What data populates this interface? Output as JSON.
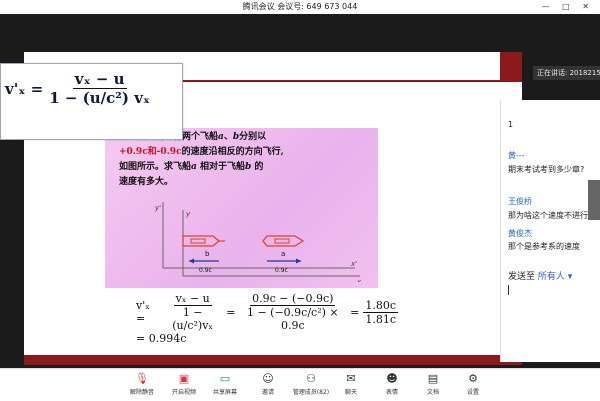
{
  "titlebar": {
    "title": "腾讯会议 会议号: 649 673 044",
    "window_controls": "— □ ✕"
  },
  "slide": {
    "title_glyphs": "",
    "problem": {
      "prefix": "在地面上测到有两个飞船",
      "line1_a": "a",
      "line1_sep": "、",
      "line1_b": "b",
      "line1_end": "分别以",
      "line2_red": "+0.9c和-0.9c",
      "line2_rest": "的速度沿相反的方向飞行,",
      "line3": "如图所示。求飞船",
      "line3_a": "a",
      "line3_mid": " 相对于飞船",
      "line3_b": "b",
      "line3_end": " 的",
      "line4": "速度有多大。"
    },
    "diagram": {
      "yprime": "y'",
      "y": "y",
      "xprime": "x'",
      "x": "x",
      "ship_b": "b",
      "ship_a": "a",
      "vel_b": "0.9c",
      "vel_a": "0.9c",
      "colors": {
        "ship": "#d9462a",
        "arrow": "#1b3b9a"
      }
    },
    "formula": {
      "lhs": "v'ₓ =",
      "frac1_num": "vₓ − u",
      "frac1_den": "1 − (u/c²)vₓ",
      "eq": "=",
      "frac2_num": "0.9c − (−0.9c)",
      "frac2_den": "1 − (−0.9c/c²) × 0.9c",
      "frac3_num": "1.80c",
      "frac3_den": "1.81c",
      "result": "= 0.994c"
    }
  },
  "overlay": {
    "lhs": "v'ₓ =",
    "num": "vₓ − u",
    "den": "1 − (u/c²) vₓ"
  },
  "speaker": {
    "label": "正在讲话: 2018215"
  },
  "chat": {
    "messages": [
      {
        "name": "",
        "text": "1"
      },
      {
        "name": "黄---",
        "text": "期末考试考到多少章?"
      },
      {
        "name": "王俊桥",
        "text": "那为啥这个速度不进行变换"
      },
      {
        "name": "黄俊杰",
        "text": "那个是参考系的速度"
      }
    ],
    "send_to_label": "发送至",
    "send_to_value": "所有人",
    "send_to_chevron": "▾"
  },
  "toolbar": {
    "items": [
      {
        "label": "解除静音",
        "icon": "mic-muted-icon"
      },
      {
        "label": "开启视频",
        "icon": "camera-off-icon"
      },
      {
        "label": "共享屏幕",
        "icon": "share-screen-icon"
      },
      {
        "label": "邀请",
        "icon": "invite-icon"
      },
      {
        "label": "管理成员(82)",
        "icon": "members-icon"
      },
      {
        "label": "聊天",
        "icon": "chat-icon"
      },
      {
        "label": "表情",
        "icon": "emoji-icon"
      },
      {
        "label": "文档",
        "icon": "document-icon"
      },
      {
        "label": "设置",
        "icon": "settings-icon"
      }
    ]
  }
}
